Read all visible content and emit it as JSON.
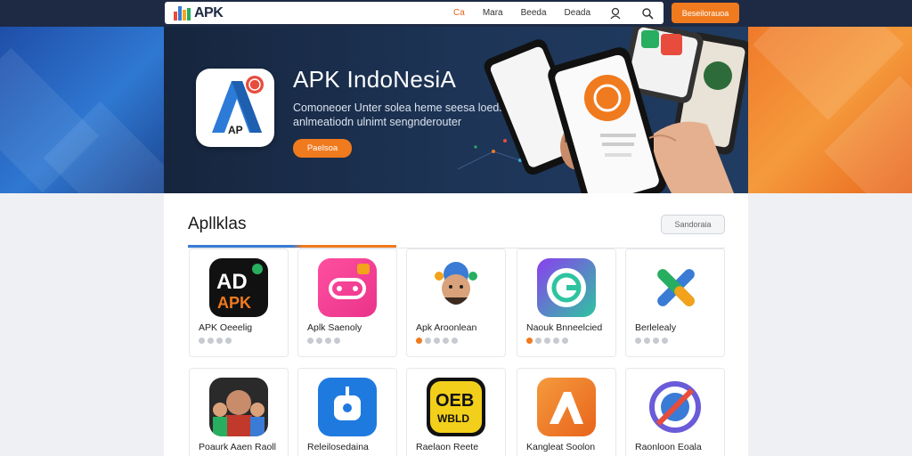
{
  "brand": {
    "name": "APK"
  },
  "nav": {
    "links": [
      "Ca",
      "Mara",
      "Beeda",
      "Deada"
    ],
    "cta": "Beseilorauoa"
  },
  "hero": {
    "title": "APK IndoNesiA",
    "subtitle": "Comoneoer Unter solea heme seesa loeds anlmeatiodn ulnimt sengnderouter",
    "button": "Paelsoa",
    "logo_text": "AP"
  },
  "section": {
    "title": "Apllklas",
    "see_all": "Sandoraia"
  },
  "apps": [
    {
      "name": "APK Oeeelig",
      "icon": "ad-apk-icon",
      "accent": "#111111"
    },
    {
      "name": "Aplk Saenoly",
      "icon": "gamepad-icon",
      "accent": "#e9338a"
    },
    {
      "name": "Apk Aroonlean",
      "icon": "avatar-character-icon",
      "accent": "#3a7bd5"
    },
    {
      "name": "Naouk Bnneelcied",
      "icon": "g-logo-icon",
      "accent": "#7b3fe4"
    },
    {
      "name": "Berlelealy",
      "icon": "x-cross-icon",
      "accent": "#f3a21b"
    },
    {
      "name": "Poaurk Aaen Raoll",
      "icon": "people-icon",
      "accent": "#c0392b"
    },
    {
      "name": "Releilosedaina",
      "icon": "robot-icon",
      "accent": "#1f7ae0"
    },
    {
      "name": "Raelaon Reete",
      "icon": "oeb-logo-icon",
      "accent": "#f2cf1a"
    },
    {
      "name": "Kangleat Soolon",
      "icon": "a-triangle-icon",
      "accent": "#f07a1e"
    },
    {
      "name": "Raonloon Eoala",
      "icon": "no-entry-icon",
      "accent": "#6a5bd9"
    }
  ],
  "colors": {
    "accent_orange": "#f07a1e",
    "accent_blue": "#3a7bd5",
    "hero_bg": "#1d3456"
  }
}
